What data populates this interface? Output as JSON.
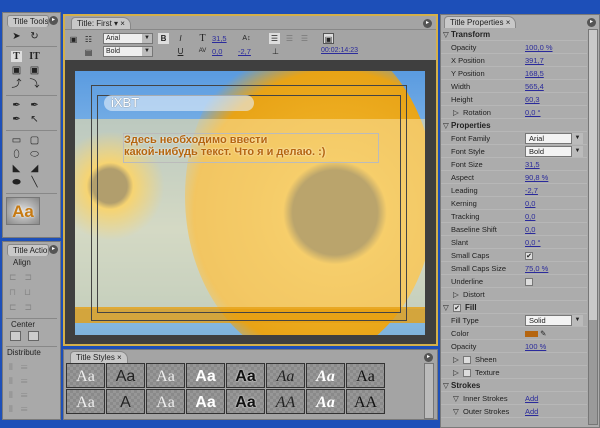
{
  "tools_panel": {
    "title": "Title Tools",
    "preview_label": "Aa"
  },
  "actions_panel": {
    "title": "Title Actions",
    "align": "Align",
    "center": "Center",
    "distribute": "Distribute"
  },
  "title_panel": {
    "tab": "Title: First",
    "font_family": "Arial",
    "font_style": "Bold",
    "bold_label": "B",
    "italic_label": "I",
    "underline_label": "U",
    "font_size": "31,5",
    "kerning": "0,0",
    "leading": "-2,7",
    "timecode": "00:02:14:23"
  },
  "canvas": {
    "logo_text": "iXBT",
    "line1": "Здесь необходимо ввести",
    "line2": "какой-нибудь текст. Что я и делаю.  :)"
  },
  "styles_panel": {
    "title": "Title Styles",
    "samples": [
      "Aa",
      "Aa",
      "Aa",
      "Aa",
      "Aa",
      "Aa",
      "Aa",
      "Aa",
      "Aa",
      "A",
      "Aa",
      "Aa",
      "Aa",
      "AA",
      "Aa",
      "AA"
    ]
  },
  "properties": {
    "title": "Title Properties",
    "transform": "Transform",
    "rows": [
      {
        "label": "Opacity",
        "value": "100,0 %"
      },
      {
        "label": "X Position",
        "value": "391,7"
      },
      {
        "label": "Y Position",
        "value": "168,5"
      },
      {
        "label": "Width",
        "value": "565,4"
      },
      {
        "label": "Height",
        "value": "60,3"
      }
    ],
    "rotation": {
      "label": "Rotation",
      "value": "0,0 °"
    },
    "properties_section": "Properties",
    "font_family": {
      "label": "Font Family",
      "value": "Arial"
    },
    "font_style": {
      "label": "Font Style",
      "value": "Bold"
    },
    "rows2": [
      {
        "label": "Font Size",
        "value": "31,5"
      },
      {
        "label": "Aspect",
        "value": "90,8 %"
      },
      {
        "label": "Leading",
        "value": "-2,7"
      },
      {
        "label": "Kerning",
        "value": "0,0"
      },
      {
        "label": "Tracking",
        "value": "0,0"
      },
      {
        "label": "Baseline Shift",
        "value": "0,0"
      },
      {
        "label": "Slant",
        "value": "0,0 °"
      }
    ],
    "small_caps": "Small Caps",
    "small_caps_size": {
      "label": "Small Caps Size",
      "value": "75,0 %"
    },
    "underline": "Underline",
    "distort": "Distort",
    "fill": "Fill",
    "fill_type": {
      "label": "Fill Type",
      "value": "Solid"
    },
    "color": {
      "label": "Color",
      "value": "#b5650f"
    },
    "fill_opacity": {
      "label": "Opacity",
      "value": "100 %"
    },
    "sheen": "Sheen",
    "texture": "Texture",
    "strokes": "Strokes",
    "inner_strokes": {
      "label": "Inner Strokes",
      "value": "Add"
    },
    "outer_strokes": {
      "label": "Outer Strokes",
      "value": "Add"
    }
  }
}
